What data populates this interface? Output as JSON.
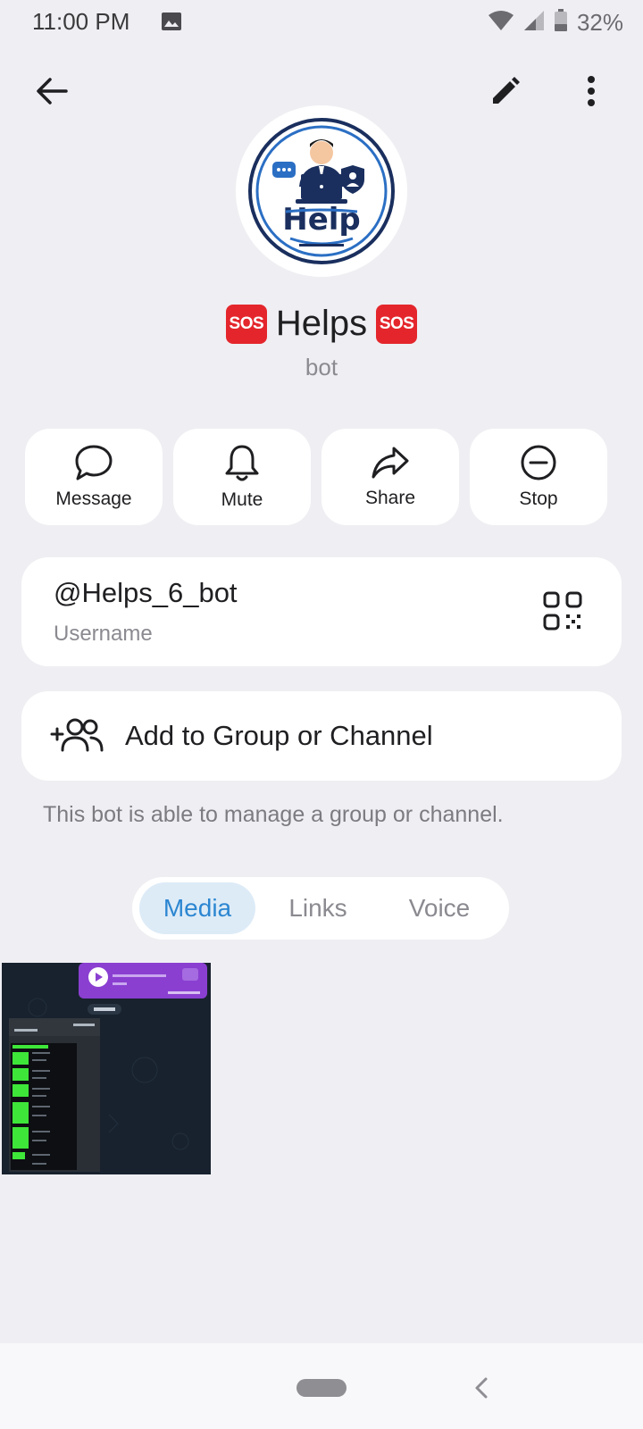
{
  "status_bar": {
    "time": "11:00 PM",
    "battery": "32%",
    "icons": [
      "image-icon",
      "wifi-icon",
      "signal-icon",
      "battery-icon"
    ]
  },
  "topbar": {
    "icons": [
      "back-arrow-icon",
      "edit-pencil-icon",
      "more-vert-icon"
    ]
  },
  "profile": {
    "avatar_logo_text": "Help",
    "name": "Helps",
    "emoji_badge": "SOS",
    "subtitle": "bot"
  },
  "actions": [
    {
      "label": "Message",
      "icon": "message-bubble-icon"
    },
    {
      "label": "Mute",
      "icon": "bell-icon"
    },
    {
      "label": "Share",
      "icon": "share-arrow-icon"
    },
    {
      "label": "Stop",
      "icon": "stop-minus-circle-icon"
    }
  ],
  "username": {
    "value": "@Helps_6_bot",
    "label": "Username",
    "icon": "qr-code-icon"
  },
  "add_group": {
    "label": "Add to Group or Channel",
    "icon": "add-users-icon"
  },
  "hint": "This bot is able to manage a group or channel.",
  "tabs": [
    {
      "label": "Media",
      "active": true
    },
    {
      "label": "Links",
      "active": false
    },
    {
      "label": "Voice",
      "active": false
    }
  ],
  "colors": {
    "accent": "#2c86d1",
    "tab_active_bg": "#ddebf7",
    "background": "#efeff3",
    "sos_red": "#e4262c",
    "logo_navy": "#1a2f5e"
  }
}
